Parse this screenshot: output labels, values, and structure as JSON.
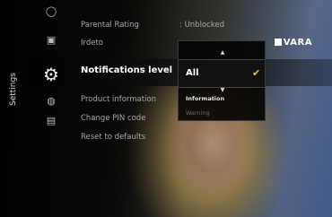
{
  "brand": {
    "logo_text": "VARA"
  },
  "sidebar": {
    "title": "Settings"
  },
  "icons": [
    {
      "name": "circle-icon",
      "glyph": "◯"
    },
    {
      "name": "screen-icon",
      "glyph": "▣"
    },
    {
      "name": "gears-icon",
      "glyph": "⚙"
    },
    {
      "name": "globe-icon",
      "glyph": "◍"
    },
    {
      "name": "card-icon",
      "glyph": "▤"
    }
  ],
  "menu": {
    "items": [
      {
        "label": "Parental Rating",
        "value": ": Unblocked"
      },
      {
        "label": "Irdeto",
        "value": ""
      },
      {
        "label": "Notifications level",
        "value": ""
      },
      {
        "label": "Product information",
        "value": ""
      },
      {
        "label": "Change PIN code",
        "value": ""
      },
      {
        "label": "Reset to defaults",
        "value": ""
      }
    ],
    "selected_index": 2
  },
  "dropdown": {
    "selected": "All",
    "check_glyph": "✔",
    "up_arrow": "▲",
    "down_arrow": "▼",
    "options": [
      "Information",
      "Warning"
    ]
  },
  "colors": {
    "check": "#f2d22a",
    "selected_text": "#ffffff",
    "menu_text": "#a8a8a8"
  }
}
